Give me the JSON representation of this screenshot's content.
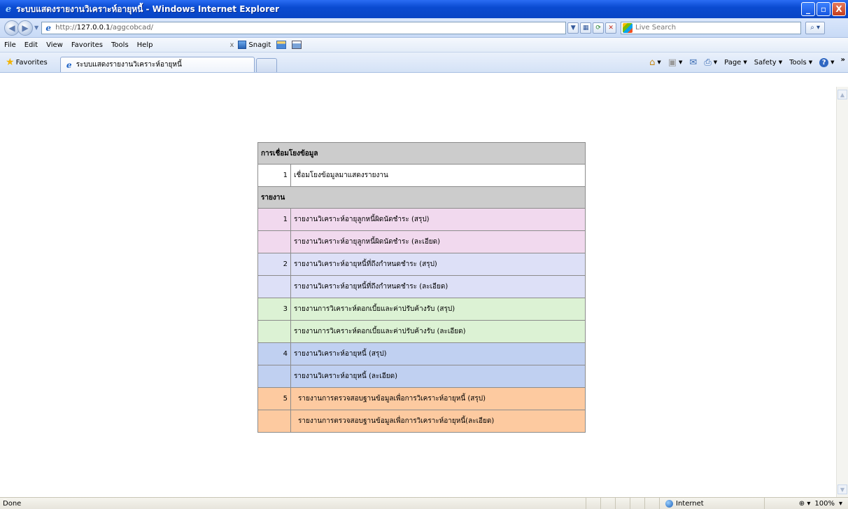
{
  "window": {
    "title": "ระบบแสดงรายงานวิเคราะห์อายุหนี้ - Windows Internet Explorer",
    "buttons": {
      "minimize": "_",
      "maximize": "▫",
      "close": "X"
    }
  },
  "address_bar": {
    "url_prefix": "http://",
    "url_host": "127.0.0.1",
    "url_path": "/aggcobcad/",
    "search_placeholder": "Live Search"
  },
  "menu": {
    "items": [
      "File",
      "Edit",
      "View",
      "Favorites",
      "Tools",
      "Help"
    ],
    "close_x": "x",
    "snagit_label": "Snagit"
  },
  "favorites_bar": {
    "favorites_label": "Favorites",
    "tab_title": "ระบบแสดงรายงานวิเคราะห์อายุหนี้",
    "commands": [
      "Page",
      "Safety",
      "Tools"
    ]
  },
  "content": {
    "sections": [
      {
        "header": "การเชื่อมโยงข้อมูล",
        "rows": [
          {
            "num": "1",
            "label": "เชื่อมโยงข้อมูลมาแสดงรายงาน",
            "color": "white"
          }
        ]
      },
      {
        "header": "รายงาน",
        "rows": [
          {
            "num": "1",
            "label": "รายงานวิเคราะห์อายุลูกหนี้ผิดนัดชำระ (สรุป)",
            "color": "pink"
          },
          {
            "num": "",
            "label": "รายงานวิเคราะห์อายุลูกหนี้ผิดนัดชำระ (ละเอียด)",
            "color": "pink"
          },
          {
            "num": "2",
            "label": "รายงานวิเคราะห์อายุหนี้ที่ถึงกำหนดชำระ (สรุป)",
            "color": "lav"
          },
          {
            "num": "",
            "label": "รายงานวิเคราะห์อายุหนี้ที่ถึงกำหนดชำระ (ละเอียด)",
            "color": "lav"
          },
          {
            "num": "3",
            "label": "รายงานการวิเคราะห์ดอกเบี้ยและค่าปรับค้างรับ (สรุป)",
            "color": "green"
          },
          {
            "num": "",
            "label": "รายงานการวิเคราะห์ดอกเบี้ยและค่าปรับค้างรับ (ละเอียด)",
            "color": "green"
          },
          {
            "num": "4",
            "label": "รายงานวิเคราะห์อายุหนี้ (สรุป)",
            "color": "blue"
          },
          {
            "num": "",
            "label": "รายงานวิเคราะห์อายุหนี้ (ละเอียด)",
            "color": "blue"
          },
          {
            "num": "5",
            "label": "รายงานการตรวจสอบฐานข้อมูลเพื่อการวิเคราะห์อายุหนี้ (สรุป)",
            "color": "orange"
          },
          {
            "num": "",
            "label": "รายงานการตรวจสอบฐานข้อมูลเพื่อการวิเคราะห์อายุหนี้(ละเอียด)",
            "color": "orange"
          }
        ]
      }
    ],
    "row_colors": {
      "white": "#ffffff",
      "pink": "#f1d9ee",
      "lav": "#dde0f7",
      "green": "#dcf2d4",
      "blue": "#c0d0f1",
      "orange": "#fdcaa0",
      "header": "#cccccc"
    }
  },
  "status_bar": {
    "status": "Done",
    "zone": "Internet",
    "zoom": "100%"
  }
}
